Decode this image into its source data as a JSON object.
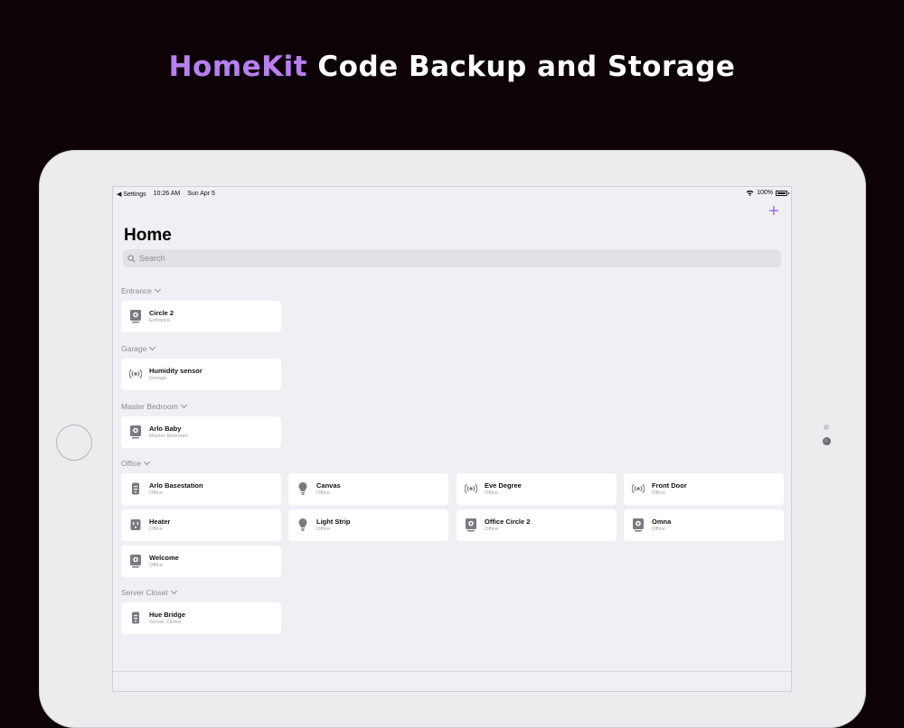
{
  "headline": {
    "accent": "HomeKit",
    "rest": "Code Backup and Storage"
  },
  "status_bar": {
    "back": "Settings",
    "time": "10:26 AM",
    "date": "Sun Apr 5",
    "battery": "100%"
  },
  "nav": {
    "add_label": "+",
    "title": "Home"
  },
  "search": {
    "placeholder": "Search"
  },
  "sections": [
    {
      "name": "Entrance"
    },
    {
      "name": "Garage"
    },
    {
      "name": "Master Bedroom"
    },
    {
      "name": "Office"
    },
    {
      "name": "Server Closet"
    }
  ],
  "accessories": [
    {
      "name": "Circle 2",
      "room": "Entrance",
      "icon": "camera-icon"
    },
    {
      "name": "Humidity sensor",
      "room": "Garage",
      "icon": "sensor-icon"
    },
    {
      "name": "Arlo Baby",
      "room": "Master Bedroom",
      "icon": "camera-icon"
    },
    {
      "name": "Arlo Basestation",
      "room": "Office",
      "icon": "bridge-icon"
    },
    {
      "name": "Canvas",
      "room": "Office",
      "icon": "lightbulb-icon"
    },
    {
      "name": "Eve Degree",
      "room": "Office",
      "icon": "sensor-icon"
    },
    {
      "name": "Front Door",
      "room": "Office",
      "icon": "sensor-icon"
    },
    {
      "name": "Heater",
      "room": "Office",
      "icon": "outlet-icon"
    },
    {
      "name": "Light Strip",
      "room": "Office",
      "icon": "lightbulb-icon"
    },
    {
      "name": "Office Circle 2",
      "room": "Office",
      "icon": "camera-icon"
    },
    {
      "name": "Omna",
      "room": "Office",
      "icon": "camera-icon"
    },
    {
      "name": "Welcome",
      "room": "Office",
      "icon": "camera-icon"
    },
    {
      "name": "Hue Bridge",
      "room": "Server Closet",
      "icon": "bridge-icon"
    }
  ],
  "colors": {
    "accent": "#b77ff0",
    "background": "#0d0307",
    "screen": "#efeff4",
    "tile": "#ffffff"
  }
}
